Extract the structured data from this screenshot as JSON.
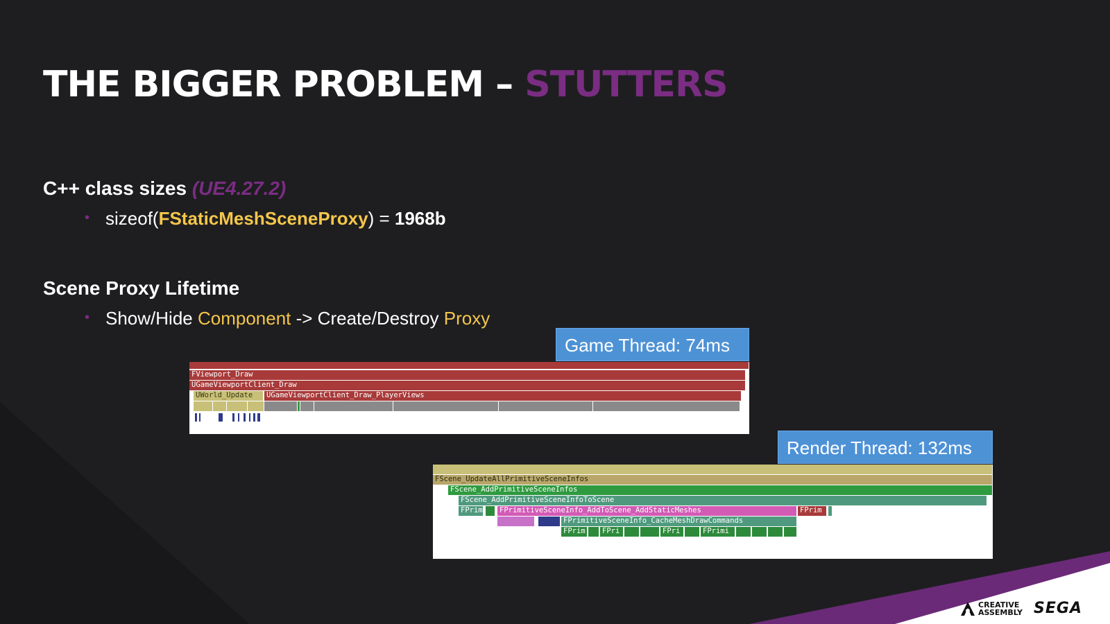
{
  "title": {
    "main": "THE BIGGER PROBLEM – ",
    "accent": "STUTTERS"
  },
  "section1": {
    "heading": "C++ class sizes",
    "version": "(UE4.27.2)",
    "bullet": {
      "prefix": "sizeof(",
      "cls": "FStaticMeshSceneProxy",
      "suffix": ") = ",
      "value": "1968b"
    }
  },
  "section2": {
    "heading": "Scene Proxy Lifetime",
    "bullet": {
      "p1": "Show/Hide ",
      "w1": "Component",
      "p2": " -> Create/Destroy ",
      "w2": "Proxy"
    }
  },
  "game_thread": {
    "label": "Game Thread: 74ms",
    "rows": [
      "FViewport_Draw",
      "UGameViewportClient_Draw",
      "UWorld_Update",
      "UGameViewportClient_Draw_PlayerViews"
    ]
  },
  "render_thread": {
    "label": "Render Thread: 132ms",
    "rows": [
      "FScene_UpdateAllPrimitiveSceneInfos",
      "FScene_AddPrimitiveSceneInfos",
      "FScene_AddPrimitiveSceneInfoToScene",
      "FPrim",
      "FPrimitiveSceneInfo_AddToScene_AddStaticMeshes",
      "FPrim",
      "FPrimitiveSceneInfo_CacheMeshDrawCommands",
      "FPrim",
      "FPri",
      "FPri",
      "FPrimi"
    ]
  },
  "logos": {
    "creative_line1": "CREATIVE",
    "creative_line2": "ASSEMBLY",
    "sega": "SEGA"
  },
  "colors": {
    "accent": "#7a2d82",
    "highlight": "#f4c64b",
    "badge": "#4e92d6",
    "background": "#1e1e20"
  }
}
